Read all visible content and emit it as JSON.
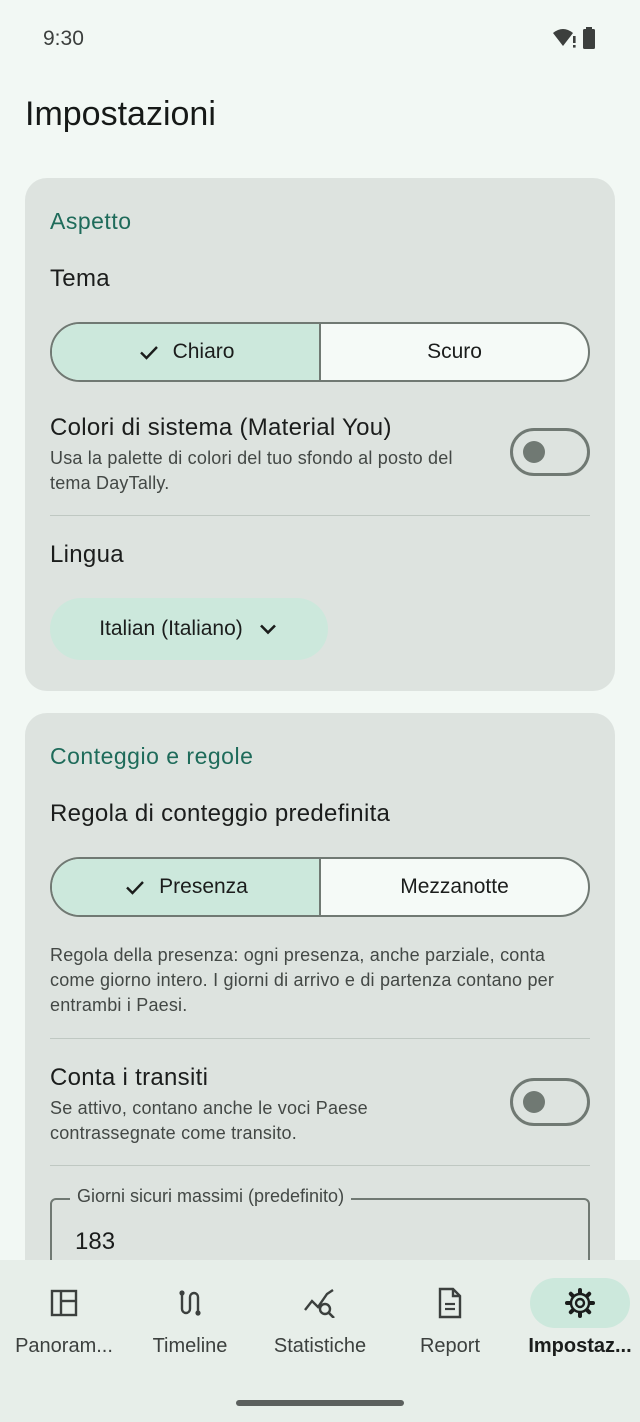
{
  "status": {
    "time": "9:30",
    "icons": [
      "wifi-alert-icon",
      "battery-icon"
    ]
  },
  "header": {
    "title": "Impostazioni"
  },
  "aspetto": {
    "section_title": "Aspetto",
    "theme_label": "Tema",
    "theme_options": [
      {
        "label": "Chiaro",
        "selected": true
      },
      {
        "label": "Scuro",
        "selected": false
      }
    ],
    "dynamic_colors": {
      "title": "Colori di sistema (Material You)",
      "description": "Usa la palette di colori del tuo sfondo al posto del tema DayTally.",
      "enabled": false
    },
    "language_label": "Lingua",
    "language_value": "Italian (Italiano)"
  },
  "conteggio": {
    "section_title": "Conteggio e regole",
    "rule_label": "Regola di conteggio predefinita",
    "rule_options": [
      {
        "label": "Presenza",
        "selected": true
      },
      {
        "label": "Mezzanotte",
        "selected": false
      }
    ],
    "rule_description": "Regola della presenza: ogni presenza, anche parziale, conta come giorno intero. I giorni di arrivo e di partenza contano per entrambi i Paesi.",
    "transit": {
      "title": "Conta i transiti",
      "description": "Se attivo, contano anche le voci Paese contrassegnate come transito.",
      "enabled": false
    },
    "max_days": {
      "label": "Giorni sicuri massimi (predefinito)",
      "value": "183"
    }
  },
  "nav": [
    {
      "label": "Panoram...",
      "icon": "dashboard-icon",
      "active": false
    },
    {
      "label": "Timeline",
      "icon": "timeline-icon",
      "active": false
    },
    {
      "label": "Statistiche",
      "icon": "stats-icon",
      "active": false
    },
    {
      "label": "Report",
      "icon": "report-icon",
      "active": false
    },
    {
      "label": "Impostaz...",
      "icon": "settings-icon",
      "active": true
    }
  ],
  "colors": {
    "accent": "#1e6b5a",
    "selected_bg": "#cce8dc",
    "card_bg": "#dde3df",
    "page_bg": "#f2f8f4"
  }
}
